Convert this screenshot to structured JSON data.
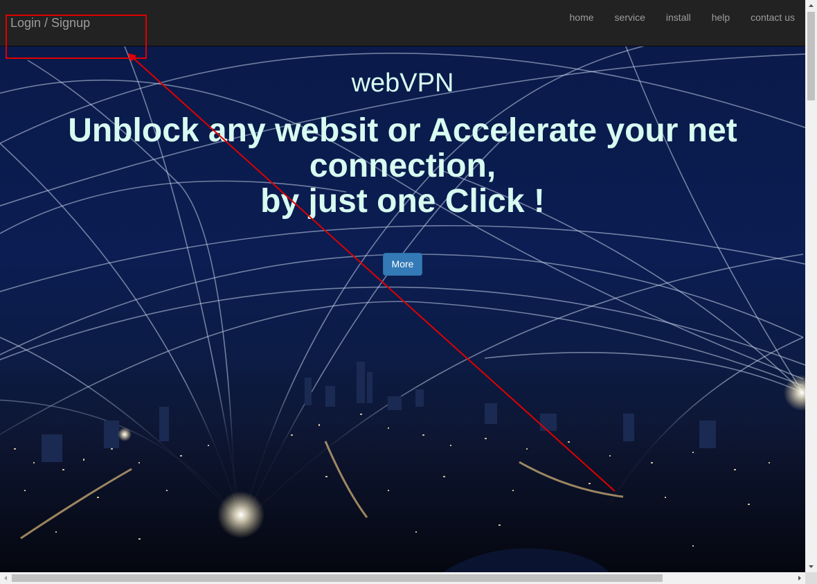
{
  "navbar": {
    "brand_label": "Login / Signup",
    "links": [
      {
        "label": "home"
      },
      {
        "label": "service"
      },
      {
        "label": "install"
      },
      {
        "label": "help"
      },
      {
        "label": "contact us"
      }
    ]
  },
  "hero": {
    "site_title": "webVPN",
    "headline_lines": [
      "Unblock any websit or Accelerate your net",
      "connection,",
      "by just one Click !"
    ],
    "more_button_label": "More"
  },
  "colors": {
    "navbar_bg": "#222222",
    "nav_text": "#9d9d9d",
    "hero_text": "#d7fbf0",
    "button_bg": "#337ab7",
    "annotation_red": "#e00000"
  },
  "icons": {
    "scroll_up": "triangle-up",
    "scroll_down": "triangle-down",
    "scroll_left": "triangle-left",
    "scroll_right": "triangle-right"
  }
}
